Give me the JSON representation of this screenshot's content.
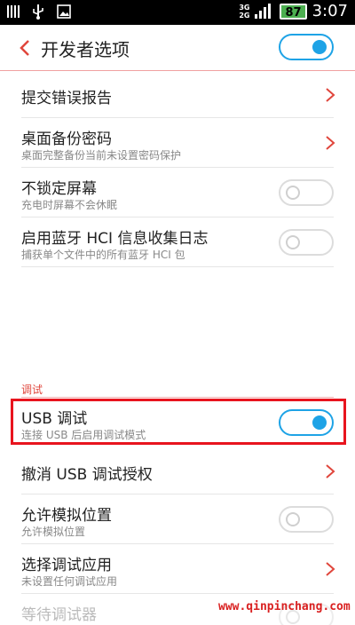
{
  "status_bar": {
    "net_top": "3G",
    "net_bottom": "2G",
    "battery": "87",
    "time": "3:07"
  },
  "header": {
    "title": "开发者选项",
    "master_toggle_on": true
  },
  "items": [
    {
      "title": "提交错误报告",
      "subtitle": "",
      "control": "chevron"
    },
    {
      "title": "桌面备份密码",
      "subtitle": "桌面完整备份当前未设置密码保护",
      "control": "chevron"
    },
    {
      "title": "不锁定屏幕",
      "subtitle": "充电时屏幕不会休眠",
      "control": "toggle",
      "on": false
    },
    {
      "title": "启用蓝牙 HCI 信息收集日志",
      "subtitle": "捕获单个文件中的所有蓝牙 HCI 包",
      "control": "toggle",
      "on": false
    }
  ],
  "debug_section": {
    "label": "调试",
    "items": [
      {
        "title": "USB 调试",
        "subtitle": "连接 USB 后启用调试模式",
        "control": "toggle",
        "on": true
      },
      {
        "title": "撤消 USB 调试授权",
        "subtitle": "",
        "control": "chevron"
      },
      {
        "title": "允许模拟位置",
        "subtitle": "允许模拟位置",
        "control": "toggle",
        "on": false
      },
      {
        "title": "选择调试应用",
        "subtitle": "未设置任何调试应用",
        "control": "chevron"
      },
      {
        "title": "等待调试器",
        "subtitle": "",
        "control": "toggle",
        "on": false
      }
    ]
  },
  "watermark": "www.qinpinchang.com",
  "colors": {
    "accent": "#1ea3e6",
    "highlight": "#e8141e",
    "section": "#e0463c"
  }
}
